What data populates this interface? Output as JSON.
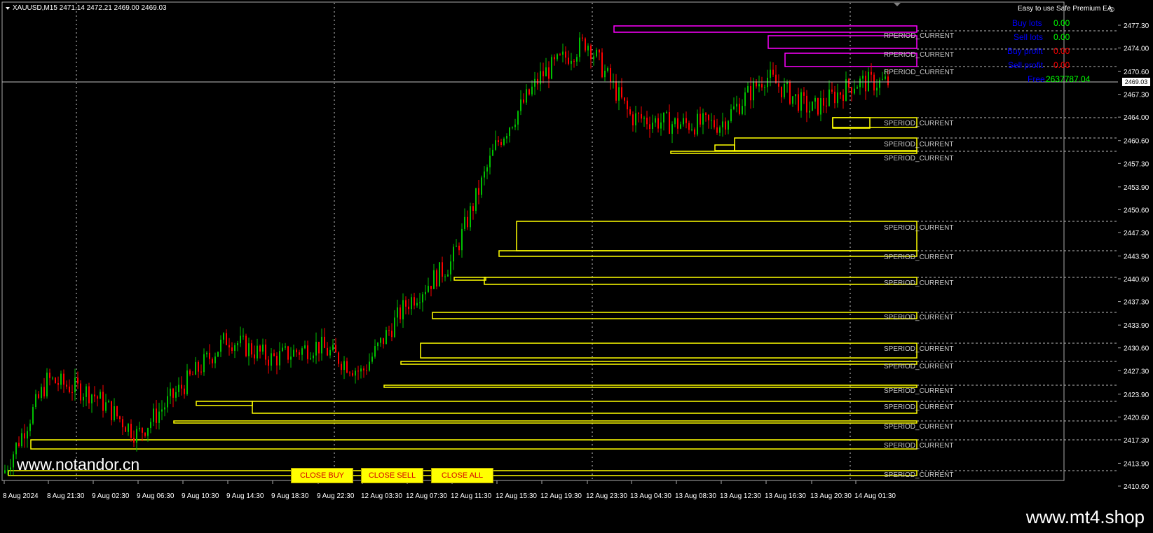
{
  "window": {
    "symbol_header": "XAUUSD,M15  2471.14 2472.21 2469.00 2469.03",
    "ea_name": "Easy to use Safe Premium EA",
    "current_price": "2469.03"
  },
  "info_panel": {
    "buy_lots_label": "Buy lots",
    "buy_lots_value": "0.00",
    "sell_lots_label": "Sell lots",
    "sell_lots_value": "0.00",
    "buy_profit_label": "Buy profit",
    "buy_profit_value": "0.00",
    "sell_profit_label": "Sell profit",
    "sell_profit_value": "0.00",
    "free_label": "Free",
    "free_value": "2637787.04"
  },
  "buttons": {
    "close_buy": "CLOSE BUY",
    "close_sell": "CLOSE SELL",
    "close_all": "CLOSE ALL"
  },
  "watermarks": {
    "left": "www.notandor.cn",
    "right": "www.mt4.shop"
  },
  "zone_labels": {
    "resistance": "RPERIOD_CURRENT",
    "support": "SPERIOD_CURRENT"
  },
  "colors": {
    "background": "#000000",
    "up_candle": "#00c000",
    "down_candle": "#ff0000",
    "support_zone": "#ffff00",
    "resistance_zone": "#ff00ff",
    "info_label": "#0000ff",
    "info_value_green": "#00ff00",
    "info_value_red": "#ff0000"
  },
  "price_axis": [
    "2477.30",
    "2474.00",
    "2470.60",
    "2467.30",
    "2464.00",
    "2460.60",
    "2457.30",
    "2453.90",
    "2450.60",
    "2447.30",
    "2443.90",
    "2440.60",
    "2437.30",
    "2433.90",
    "2430.60",
    "2427.30",
    "2423.90",
    "2420.60",
    "2417.30",
    "2413.90",
    "2410.60"
  ],
  "time_axis": [
    "8 Aug 2024",
    "8 Aug 21:30",
    "9 Aug 02:30",
    "9 Aug 06:30",
    "9 Aug 10:30",
    "9 Aug 14:30",
    "9 Aug 18:30",
    "9 Aug 22:30",
    "12 Aug 03:30",
    "12 Aug 07:30",
    "12 Aug 11:30",
    "12 Aug 15:30",
    "12 Aug 19:30",
    "12 Aug 23:30",
    "13 Aug 04:30",
    "13 Aug 08:30",
    "13 Aug 12:30",
    "13 Aug 16:30",
    "13 Aug 20:30",
    "14 Aug 01:30"
  ],
  "chart_data": {
    "type": "candlestick",
    "price_range": [
      2410.6,
      2477.3
    ],
    "close_path": [
      [
        "8 Aug 2024",
        2412.5
      ],
      [
        "8 Aug 21:30",
        2426
      ],
      [
        "9 Aug 02:30",
        2424
      ],
      [
        "9 Aug 06:30",
        2418
      ],
      [
        "9 Aug 10:30",
        2425
      ],
      [
        "9 Aug 14:30",
        2432
      ],
      [
        "9 Aug 18:30",
        2429
      ],
      [
        "9 Aug 22:30",
        2431
      ],
      [
        "12 Aug 03:30",
        2427
      ],
      [
        "12 Aug 07:30",
        2437
      ],
      [
        "12 Aug 11:30",
        2443
      ],
      [
        "12 Aug 15:30",
        2460
      ],
      [
        "12 Aug 19:30",
        2470
      ],
      [
        "12 Aug 23:30",
        2475
      ],
      [
        "13 Aug 04:30",
        2464
      ],
      [
        "13 Aug 08:30",
        2463
      ],
      [
        "13 Aug 12:30",
        2463
      ],
      [
        "13 Aug 16:30",
        2470
      ],
      [
        "13 Aug 20:30",
        2465
      ],
      [
        "14 Aug 01:30",
        2469
      ]
    ]
  }
}
